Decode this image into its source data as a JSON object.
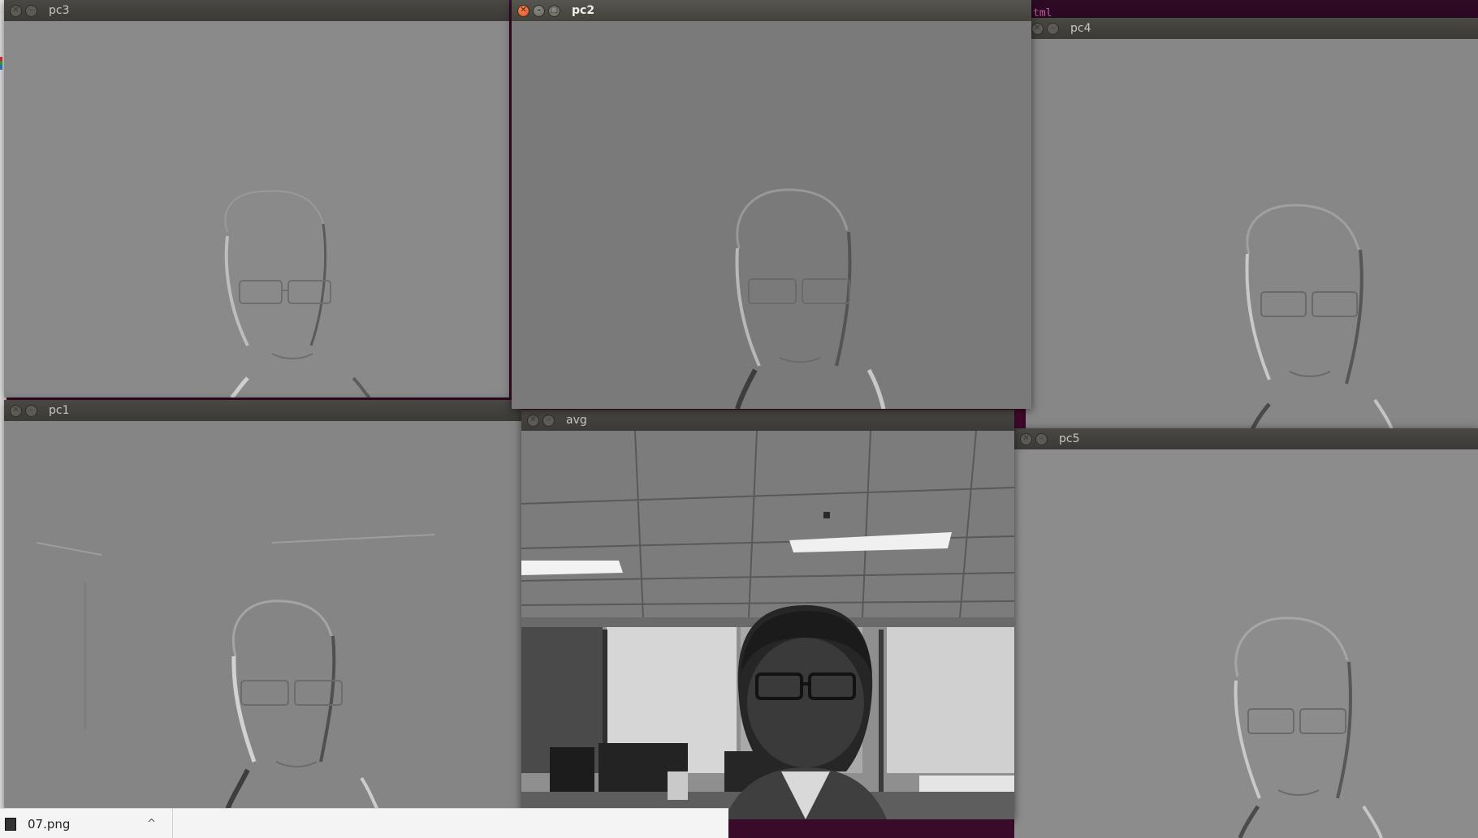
{
  "terminal": {
    "peek_text": "tml"
  },
  "windows": {
    "pc3": {
      "title": "pc3"
    },
    "pc2": {
      "title": "pc2"
    },
    "pc4": {
      "title": "pc4"
    },
    "pc1": {
      "title": "pc1"
    },
    "avg": {
      "title": "avg"
    },
    "pc5": {
      "title": "pc5"
    }
  },
  "buttons": {
    "close_icon": "close-icon",
    "minimize_icon": "minimize-icon",
    "maximize_icon": "maximize-icon"
  },
  "download_bar": {
    "file_name": "07.png",
    "chevron": "^"
  },
  "colors": {
    "titlebar": "#3b3a36",
    "active_close": "#e1501f",
    "desktop": "#4a0c33",
    "emboss_gray": "#7b7b7b"
  }
}
